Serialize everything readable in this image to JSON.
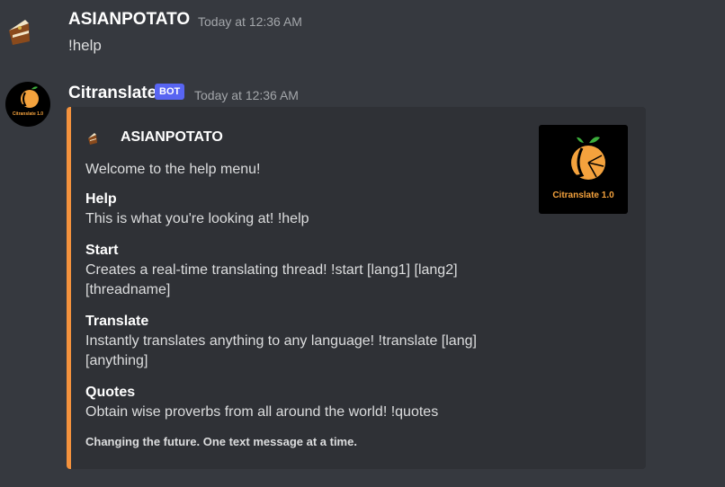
{
  "messages": [
    {
      "author": "ASIANPOTATO",
      "timestamp": "Today at 12:36 AM",
      "content": "!help",
      "avatar_icon": "potato-cake-icon"
    },
    {
      "author": "Citranslate",
      "badge": "BOT",
      "timestamp": "Today at 12:36 AM",
      "avatar_icon": "citranslate-orange-logo",
      "avatar_label": "Citranslate 1.0",
      "embed": {
        "accent_color": "#f4923d",
        "author": "ASIANPOTATO",
        "author_icon": "potato-cake-icon",
        "description": "Welcome to the help menu!",
        "fields": [
          {
            "name": "Help",
            "value": "This is what you're looking at! !help"
          },
          {
            "name": "Start",
            "value": "Creates a real-time translating thread! !start [lang1] [lang2] [threadname]"
          },
          {
            "name": "Translate",
            "value": "Instantly translates anything to any language! !translate [lang] [anything]"
          },
          {
            "name": "Quotes",
            "value": "Obtain wise proverbs from all around the world! !quotes"
          }
        ],
        "footer": "Changing the future. One text message at a time.",
        "thumbnail_icon": "citranslate-orange-logo",
        "thumbnail_label": "Citranslate 1.0"
      }
    }
  ],
  "colors": {
    "background": "#36393f",
    "embed_background": "#2f3136",
    "bot_badge": "#5865f2",
    "orange": "#f4923d"
  }
}
